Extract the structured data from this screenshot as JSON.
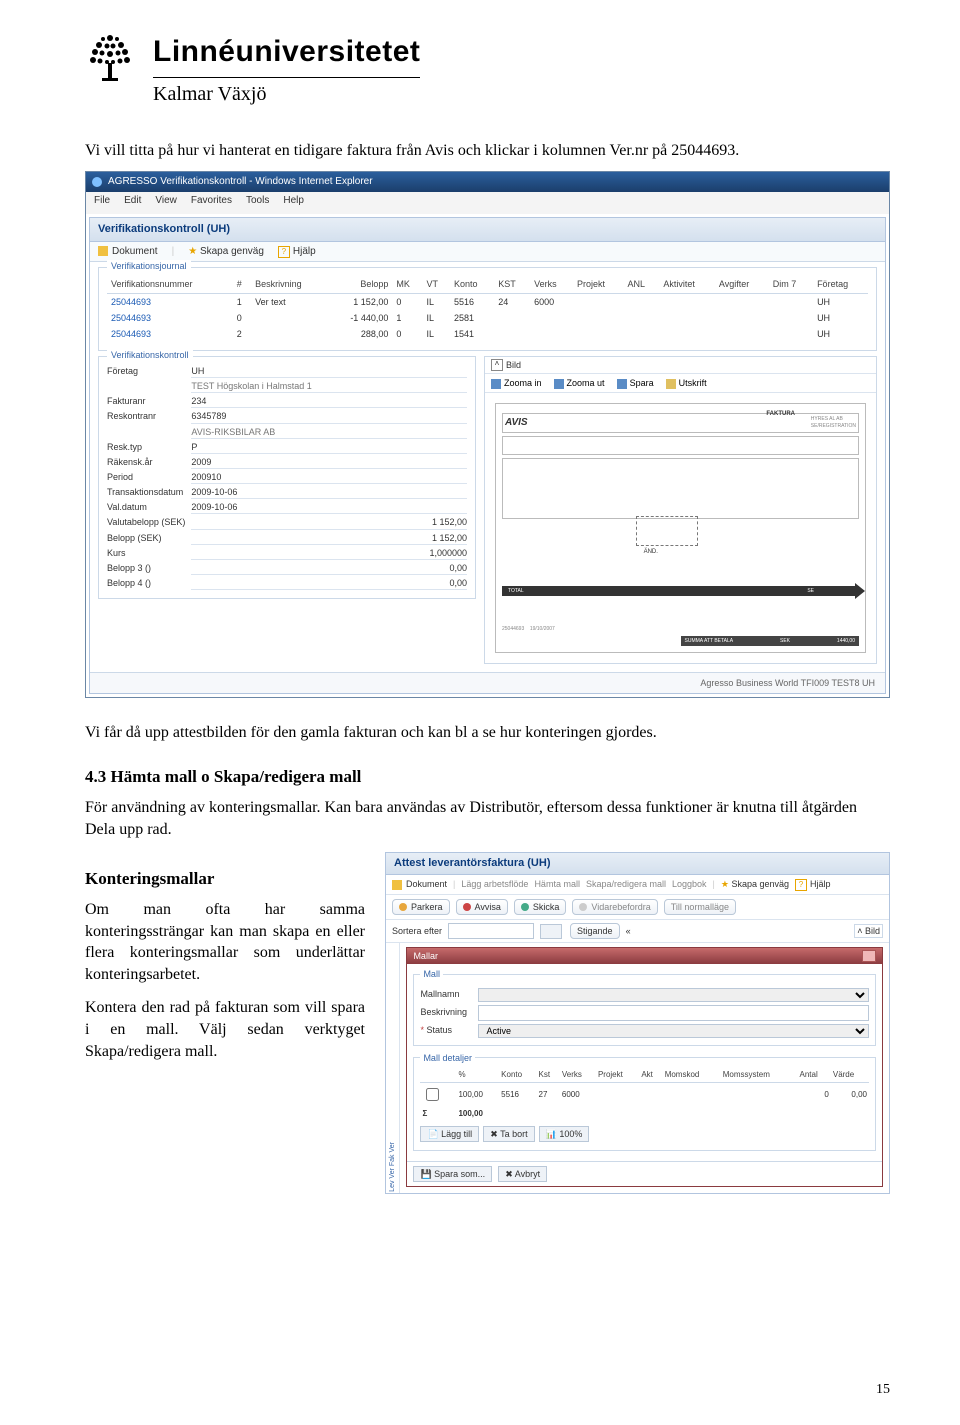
{
  "header": {
    "uni": "Linnéuniversitetet",
    "sub": "Kalmar Växjö"
  },
  "intro": "Vi vill titta på hur vi hanterat en tidigare faktura från Avis och klickar i kolumnen Ver.nr på 25044693.",
  "browser": {
    "title": "AGRESSO Verifikationskontroll - Windows Internet Explorer",
    "menu": [
      "File",
      "Edit",
      "View",
      "Favorites",
      "Tools",
      "Help"
    ]
  },
  "app": {
    "title": "Verifikationskontroll (UH)",
    "toolbar": {
      "dokument": "Dokument",
      "skapa": "Skapa genväg",
      "hjalp": "Hjälp"
    },
    "journal_label": "Verifikationsjournal",
    "kontroll_label": "Verifikationskontroll",
    "journal": {
      "headers": [
        "Verifikationsnummer",
        "#",
        "Beskrivning",
        "Belopp",
        "MK",
        "VT",
        "Konto",
        "KST",
        "Verks",
        "Projekt",
        "ANL",
        "Aktivitet",
        "Avgifter",
        "Dim 7",
        "Företag"
      ],
      "rows": [
        {
          "nr": "25044693",
          "h": "1",
          "besk": "Ver text",
          "belopp": "1 152,00",
          "mk": "0",
          "vt": "IL",
          "konto": "5516",
          "kst": "24",
          "verks": "6000",
          "foretag": "UH"
        },
        {
          "nr": "25044693",
          "h": "0",
          "besk": "",
          "belopp": "-1 440,00",
          "mk": "1",
          "vt": "IL",
          "konto": "2581",
          "kst": "",
          "verks": "",
          "foretag": "UH"
        },
        {
          "nr": "25044693",
          "h": "2",
          "besk": "",
          "belopp": "288,00",
          "mk": "0",
          "vt": "IL",
          "konto": "1541",
          "kst": "",
          "verks": "",
          "foretag": "UH"
        }
      ]
    },
    "kontroll": {
      "Företag": "UH",
      "Företag_sub": "TEST Högskolan i Halmstad 1",
      "Fakturanr": "234",
      "Reskontranr": "6345789",
      "Reskontranr_sub": "AVIS-RIKSBILAR AB",
      "Resk_typ": "P",
      "Rakensk_ar": "2009",
      "Period": "200910",
      "Transaktionsdatum": "2009-10-06",
      "Val_datum": "2009-10-06",
      "Valutabelopp": "1 152,00",
      "Belopp_SEK": "1 152,00",
      "Kurs": "1,000000",
      "Belopp3": "0,00",
      "Belopp4": "0,00"
    },
    "bild": {
      "label": "Bild",
      "zoom_in": "Zooma in",
      "zoom_out": "Zooma ut",
      "spara": "Spara",
      "utskrift": "Utskrift",
      "brand": "AVIS",
      "faktura": "FAKTURA",
      "stamp": "ÄND.",
      "total": "TOTAL",
      "summa": "SUMMA ATT BETALA",
      "sek": "SEK",
      "amt": "1440,00",
      "dateleft": "25044693",
      "date2": "19/10/2007"
    },
    "status": "Agresso Business World  TFI009  TEST8  UH"
  },
  "mid_para": "Vi får då upp attestbilden för den gamla fakturan och kan bl a se hur konteringen gjordes.",
  "sec_title": "4.3 Hämta mall o Skapa/redigera mall",
  "sec_para": "För användning av konteringsmallar. Kan bara användas av Distributör, eftersom dessa funktioner är knutna till åtgärden Dela upp rad.",
  "sub_title": "Konteringsmallar",
  "left_p1": "Om man ofta har samma konteringssträngar kan man skapa en eller flera konteringsmallar som underlättar konteringsarbetet.",
  "left_p2": "Kontera den rad på fakturan som vill spara i en mall. Välj sedan verktyget Skapa/redigera mall.",
  "mall": {
    "title": "Attest leverantörsfaktura (UH)",
    "tb": {
      "dok": "Dokument",
      "lagg_af": "Lägg arbetsflöde",
      "hamta": "Hämta mall",
      "skapa": "Skapa/redigera mall",
      "logg": "Loggbok",
      "genvag": "Skapa genväg",
      "hjalp": "Hjälp"
    },
    "chips": {
      "parkera": "Parkera",
      "avvisa": "Avvisa",
      "skicka": "Skicka",
      "vidare": "Vidarebefordra",
      "normal": "Till normalläge"
    },
    "sort": "Sortera efter",
    "sort_btn": "Stigande",
    "side": "Bild",
    "window_title": "Mallar",
    "mall_label": "Mall",
    "mallnamn": "Mallnamn",
    "beskrivning": "Beskrivning",
    "status": "Status",
    "status_val": "Active",
    "detaljer": "Mall detaljer",
    "headers": [
      "",
      "%",
      "Konto",
      "Kst",
      "Verks",
      "Projekt",
      "Akt",
      "Momskod",
      "Momssystem",
      "Antal",
      "Värde"
    ],
    "rows": [
      {
        "pct": "100,00",
        "konto": "5516",
        "kst": "27",
        "verks": "6000",
        "antal": "0",
        "varde": "0,00"
      },
      {
        "pct": "100,00"
      }
    ],
    "lagg": "Lägg till",
    "tabort": "Ta bort",
    "hundred": "100%",
    "spara": "Spara som...",
    "avbryt": "Avbryt"
  },
  "pagenum": "15"
}
